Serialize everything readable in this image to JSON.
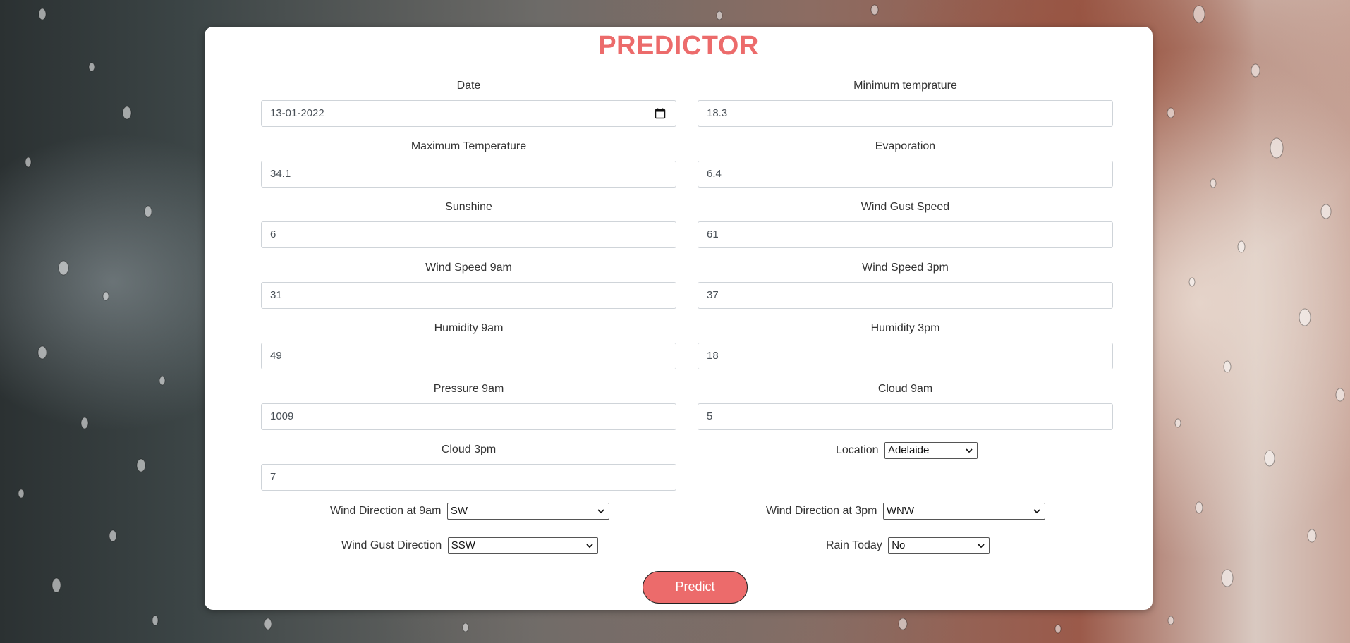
{
  "page": {
    "title": "PREDICTOR"
  },
  "colors": {
    "accent": "#ec6b6b",
    "card": "#ffffff"
  },
  "fields": {
    "date": {
      "label": "Date",
      "value": "13-01-2022"
    },
    "min_temp": {
      "label": "Minimum temprature",
      "value": "18.3"
    },
    "max_temp": {
      "label": "Maximum Temperature",
      "value": "34.1"
    },
    "evaporation": {
      "label": "Evaporation",
      "value": "6.4"
    },
    "sunshine": {
      "label": "Sunshine",
      "value": "6"
    },
    "wind_gust_speed": {
      "label": "Wind Gust Speed",
      "value": "61"
    },
    "wind_speed_9am": {
      "label": "Wind Speed 9am",
      "value": "31"
    },
    "wind_speed_3pm": {
      "label": "Wind Speed 3pm",
      "value": "37"
    },
    "humidity_9am": {
      "label": "Humidity 9am",
      "value": "49"
    },
    "humidity_3pm": {
      "label": "Humidity 3pm",
      "value": "18"
    },
    "pressure_9am": {
      "label": "Pressure 9am",
      "value": "1009"
    },
    "cloud_9am": {
      "label": "Cloud 9am",
      "value": "5"
    },
    "cloud_3pm": {
      "label": "Cloud 3pm",
      "value": "7"
    }
  },
  "selects": {
    "location": {
      "label": "Location",
      "value": "Adelaide"
    },
    "wind_dir_9am": {
      "label": "Wind Direction at 9am",
      "value": "SW"
    },
    "wind_dir_3pm": {
      "label": "Wind Direction at 3pm",
      "value": "WNW"
    },
    "wind_gust_dir": {
      "label": "Wind Gust Direction",
      "value": "SSW"
    },
    "rain_today": {
      "label": "Rain Today",
      "value": "No"
    }
  },
  "actions": {
    "predict_label": "Predict"
  },
  "icons": {
    "date_picker": "calendar-icon",
    "select_arrow": "chevron-down-icon"
  }
}
